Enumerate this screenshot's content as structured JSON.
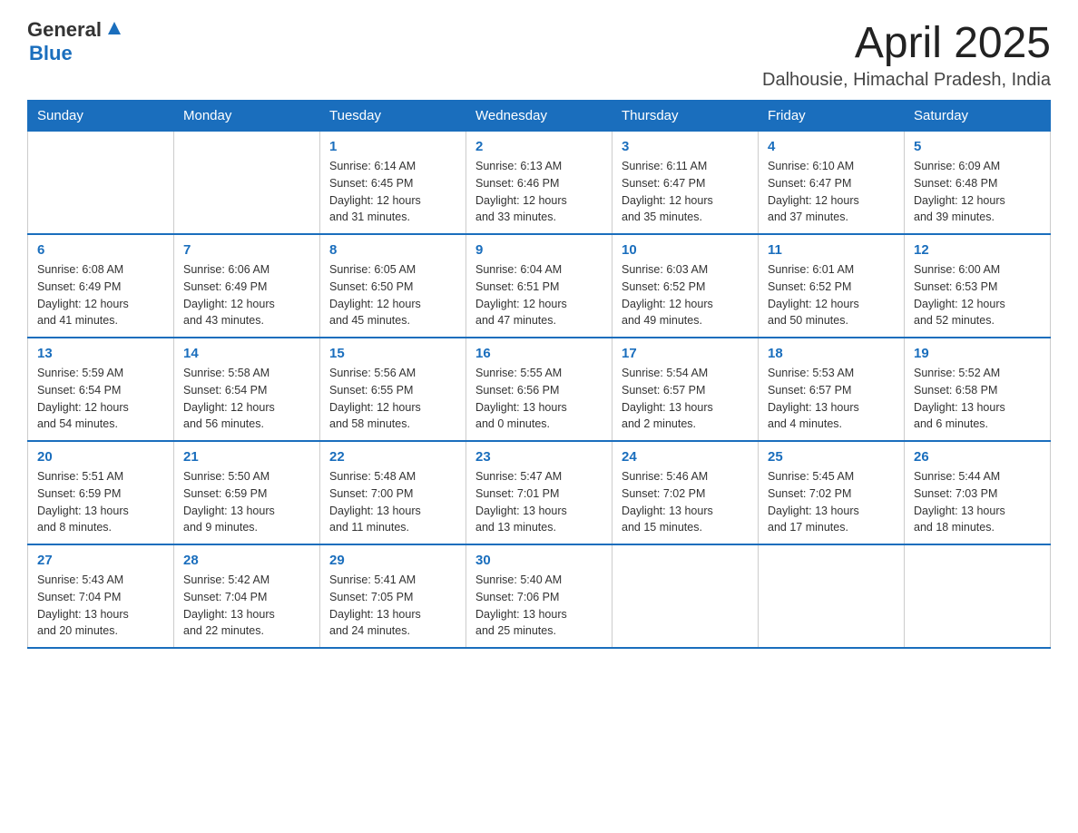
{
  "logo": {
    "text_general": "General",
    "text_blue": "Blue",
    "arrow": "▲"
  },
  "header": {
    "month_year": "April 2025",
    "location": "Dalhousie, Himachal Pradesh, India"
  },
  "weekdays": [
    "Sunday",
    "Monday",
    "Tuesday",
    "Wednesday",
    "Thursday",
    "Friday",
    "Saturday"
  ],
  "weeks": [
    [
      {
        "day": "",
        "info": ""
      },
      {
        "day": "",
        "info": ""
      },
      {
        "day": "1",
        "info": "Sunrise: 6:14 AM\nSunset: 6:45 PM\nDaylight: 12 hours\nand 31 minutes."
      },
      {
        "day": "2",
        "info": "Sunrise: 6:13 AM\nSunset: 6:46 PM\nDaylight: 12 hours\nand 33 minutes."
      },
      {
        "day": "3",
        "info": "Sunrise: 6:11 AM\nSunset: 6:47 PM\nDaylight: 12 hours\nand 35 minutes."
      },
      {
        "day": "4",
        "info": "Sunrise: 6:10 AM\nSunset: 6:47 PM\nDaylight: 12 hours\nand 37 minutes."
      },
      {
        "day": "5",
        "info": "Sunrise: 6:09 AM\nSunset: 6:48 PM\nDaylight: 12 hours\nand 39 minutes."
      }
    ],
    [
      {
        "day": "6",
        "info": "Sunrise: 6:08 AM\nSunset: 6:49 PM\nDaylight: 12 hours\nand 41 minutes."
      },
      {
        "day": "7",
        "info": "Sunrise: 6:06 AM\nSunset: 6:49 PM\nDaylight: 12 hours\nand 43 minutes."
      },
      {
        "day": "8",
        "info": "Sunrise: 6:05 AM\nSunset: 6:50 PM\nDaylight: 12 hours\nand 45 minutes."
      },
      {
        "day": "9",
        "info": "Sunrise: 6:04 AM\nSunset: 6:51 PM\nDaylight: 12 hours\nand 47 minutes."
      },
      {
        "day": "10",
        "info": "Sunrise: 6:03 AM\nSunset: 6:52 PM\nDaylight: 12 hours\nand 49 minutes."
      },
      {
        "day": "11",
        "info": "Sunrise: 6:01 AM\nSunset: 6:52 PM\nDaylight: 12 hours\nand 50 minutes."
      },
      {
        "day": "12",
        "info": "Sunrise: 6:00 AM\nSunset: 6:53 PM\nDaylight: 12 hours\nand 52 minutes."
      }
    ],
    [
      {
        "day": "13",
        "info": "Sunrise: 5:59 AM\nSunset: 6:54 PM\nDaylight: 12 hours\nand 54 minutes."
      },
      {
        "day": "14",
        "info": "Sunrise: 5:58 AM\nSunset: 6:54 PM\nDaylight: 12 hours\nand 56 minutes."
      },
      {
        "day": "15",
        "info": "Sunrise: 5:56 AM\nSunset: 6:55 PM\nDaylight: 12 hours\nand 58 minutes."
      },
      {
        "day": "16",
        "info": "Sunrise: 5:55 AM\nSunset: 6:56 PM\nDaylight: 13 hours\nand 0 minutes."
      },
      {
        "day": "17",
        "info": "Sunrise: 5:54 AM\nSunset: 6:57 PM\nDaylight: 13 hours\nand 2 minutes."
      },
      {
        "day": "18",
        "info": "Sunrise: 5:53 AM\nSunset: 6:57 PM\nDaylight: 13 hours\nand 4 minutes."
      },
      {
        "day": "19",
        "info": "Sunrise: 5:52 AM\nSunset: 6:58 PM\nDaylight: 13 hours\nand 6 minutes."
      }
    ],
    [
      {
        "day": "20",
        "info": "Sunrise: 5:51 AM\nSunset: 6:59 PM\nDaylight: 13 hours\nand 8 minutes."
      },
      {
        "day": "21",
        "info": "Sunrise: 5:50 AM\nSunset: 6:59 PM\nDaylight: 13 hours\nand 9 minutes."
      },
      {
        "day": "22",
        "info": "Sunrise: 5:48 AM\nSunset: 7:00 PM\nDaylight: 13 hours\nand 11 minutes."
      },
      {
        "day": "23",
        "info": "Sunrise: 5:47 AM\nSunset: 7:01 PM\nDaylight: 13 hours\nand 13 minutes."
      },
      {
        "day": "24",
        "info": "Sunrise: 5:46 AM\nSunset: 7:02 PM\nDaylight: 13 hours\nand 15 minutes."
      },
      {
        "day": "25",
        "info": "Sunrise: 5:45 AM\nSunset: 7:02 PM\nDaylight: 13 hours\nand 17 minutes."
      },
      {
        "day": "26",
        "info": "Sunrise: 5:44 AM\nSunset: 7:03 PM\nDaylight: 13 hours\nand 18 minutes."
      }
    ],
    [
      {
        "day": "27",
        "info": "Sunrise: 5:43 AM\nSunset: 7:04 PM\nDaylight: 13 hours\nand 20 minutes."
      },
      {
        "day": "28",
        "info": "Sunrise: 5:42 AM\nSunset: 7:04 PM\nDaylight: 13 hours\nand 22 minutes."
      },
      {
        "day": "29",
        "info": "Sunrise: 5:41 AM\nSunset: 7:05 PM\nDaylight: 13 hours\nand 24 minutes."
      },
      {
        "day": "30",
        "info": "Sunrise: 5:40 AM\nSunset: 7:06 PM\nDaylight: 13 hours\nand 25 minutes."
      },
      {
        "day": "",
        "info": ""
      },
      {
        "day": "",
        "info": ""
      },
      {
        "day": "",
        "info": ""
      }
    ]
  ]
}
